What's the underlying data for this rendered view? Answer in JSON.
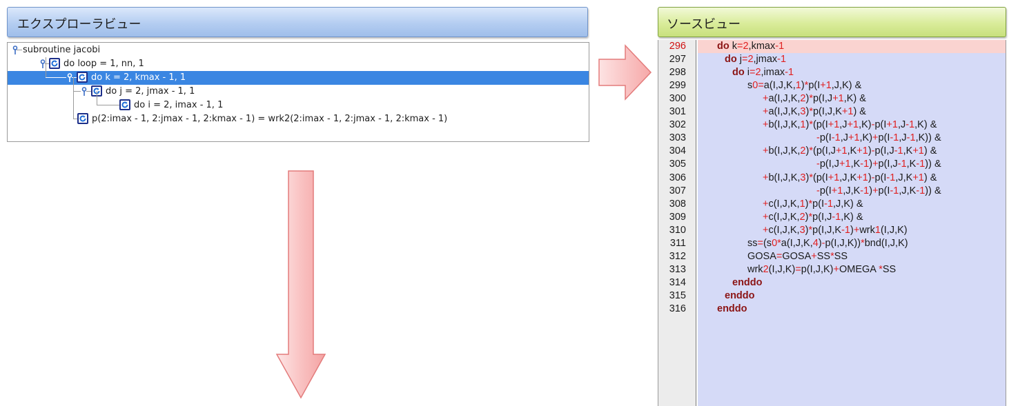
{
  "explorer": {
    "title": "エクスプローラビュー",
    "rows": [
      {
        "label": "subroutine jacobi"
      },
      {
        "label": "do loop = 1, nn, 1"
      },
      {
        "label": "do k = 2, kmax - 1, 1"
      },
      {
        "label": "do j = 2, jmax - 1, 1"
      },
      {
        "label": "do i = 2, imax - 1, 1"
      },
      {
        "label": "p(2:imax - 1, 2:jmax - 1, 2:kmax - 1) = wrk2(2:imax - 1, 2:jmax - 1, 2:kmax - 1)"
      }
    ],
    "selected_row": "do k = 2, kmax - 1, 1"
  },
  "source": {
    "title": "ソースビュー",
    "highlighted_line": "296",
    "lines": [
      {
        "num": "296",
        "text": "do k=2,kmax-1"
      },
      {
        "num": "297",
        "text": "do j=2,jmax-1"
      },
      {
        "num": "298",
        "text": "do i=2,imax-1"
      },
      {
        "num": "299",
        "text": "s0=a(I,J,K,1)*p(I+1,J,K) &"
      },
      {
        "num": "300",
        "text": "+a(I,J,K,2)*p(I,J+1,K) &"
      },
      {
        "num": "301",
        "text": "+a(I,J,K,3)*p(I,J,K+1) &"
      },
      {
        "num": "302",
        "text": "+b(I,J,K,1)*(p(I+1,J+1,K)-p(I+1,J-1,K) &"
      },
      {
        "num": "303",
        "text": "-p(I-1,J+1,K)+p(I-1,J-1,K)) &"
      },
      {
        "num": "304",
        "text": "+b(I,J,K,2)*(p(I,J+1,K+1)-p(I,J-1,K+1) &"
      },
      {
        "num": "305",
        "text": "-p(I,J+1,K-1)+p(I,J-1,K-1)) &"
      },
      {
        "num": "306",
        "text": "+b(I,J,K,3)*(p(I+1,J,K+1)-p(I-1,J,K+1) &"
      },
      {
        "num": "307",
        "text": "-p(I+1,J,K-1)+p(I-1,J,K-1)) &"
      },
      {
        "num": "308",
        "text": "+c(I,J,K,1)*p(I-1,J,K) &"
      },
      {
        "num": "309",
        "text": "+c(I,J,K,2)*p(I,J-1,K) &"
      },
      {
        "num": "310",
        "text": "+c(I,J,K,3)*p(I,J,K-1)+wrk1(I,J,K)"
      },
      {
        "num": "311",
        "text": "ss=(s0*a(I,J,K,4)-p(I,J,K))*bnd(I,J,K)"
      },
      {
        "num": "312",
        "text": "GOSA=GOSA+SS*SS"
      },
      {
        "num": "313",
        "text": "wrk2(I,J,K)=p(I,J,K)+OMEGA *SS"
      },
      {
        "num": "314",
        "text": "enddo"
      },
      {
        "num": "315",
        "text": "enddo"
      },
      {
        "num": "316",
        "text": "enddo"
      }
    ]
  },
  "colors": {
    "selection": "#3a86e2",
    "keyword": "#8b1414",
    "number": "#e02020",
    "code_background": "#d5daf7",
    "highlight_line": "#fad3d0",
    "arrow_fill": "#f9b6b6",
    "arrow_stroke": "#e07070"
  }
}
